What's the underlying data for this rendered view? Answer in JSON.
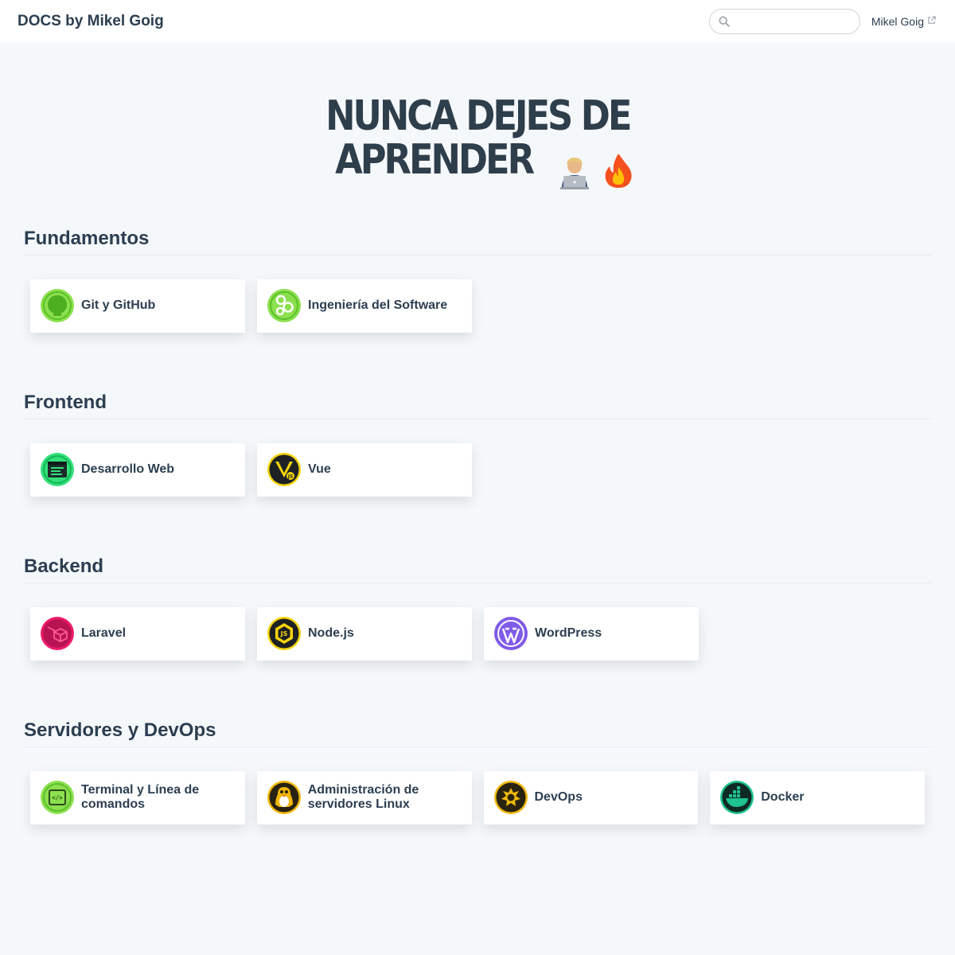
{
  "navbar": {
    "site_title": "DOCS by Mikel Goig",
    "search_placeholder": "",
    "search_value": "",
    "external_link": "Mikel Goig"
  },
  "hero": {
    "line1": "NUNCA DEJES DE",
    "line2": "APRENDER",
    "emojis": [
      "technologist",
      "fire"
    ]
  },
  "sections": [
    {
      "title": "Fundamentos",
      "cards": [
        {
          "label": "Git y GitHub",
          "icon": "github-icon",
          "color": "#8be04e"
        },
        {
          "label": "Ingeniería del Software",
          "icon": "gears-icon",
          "color": "#8be04e"
        }
      ]
    },
    {
      "title": "Frontend",
      "cards": [
        {
          "label": "Desarrollo Web",
          "icon": "browser-window-icon",
          "color": "#33e07a"
        },
        {
          "label": "Vue",
          "icon": "vuejs-icon",
          "color": "#f5d40c"
        }
      ]
    },
    {
      "title": "Backend",
      "cards": [
        {
          "label": "Laravel",
          "icon": "laravel-icon",
          "color": "#ee1b6b"
        },
        {
          "label": "Node.js",
          "icon": "nodejs-icon",
          "color": "#f5d40c"
        },
        {
          "label": "WordPress",
          "icon": "wordpress-icon",
          "color": "#7f5be8"
        }
      ]
    },
    {
      "title": "Servidores y DevOps",
      "cards": [
        {
          "label": "Terminal y Línea de comandos",
          "icon": "terminal-icon",
          "color": "#8be04e"
        },
        {
          "label": "Administración de servidores Linux",
          "icon": "linux-tux-icon",
          "color": "#f0b90b"
        },
        {
          "label": "DevOps",
          "icon": "devops-gears-icon",
          "color": "#f0b90b"
        },
        {
          "label": "Docker",
          "icon": "docker-icon",
          "color": "#1ec38e"
        }
      ]
    }
  ]
}
